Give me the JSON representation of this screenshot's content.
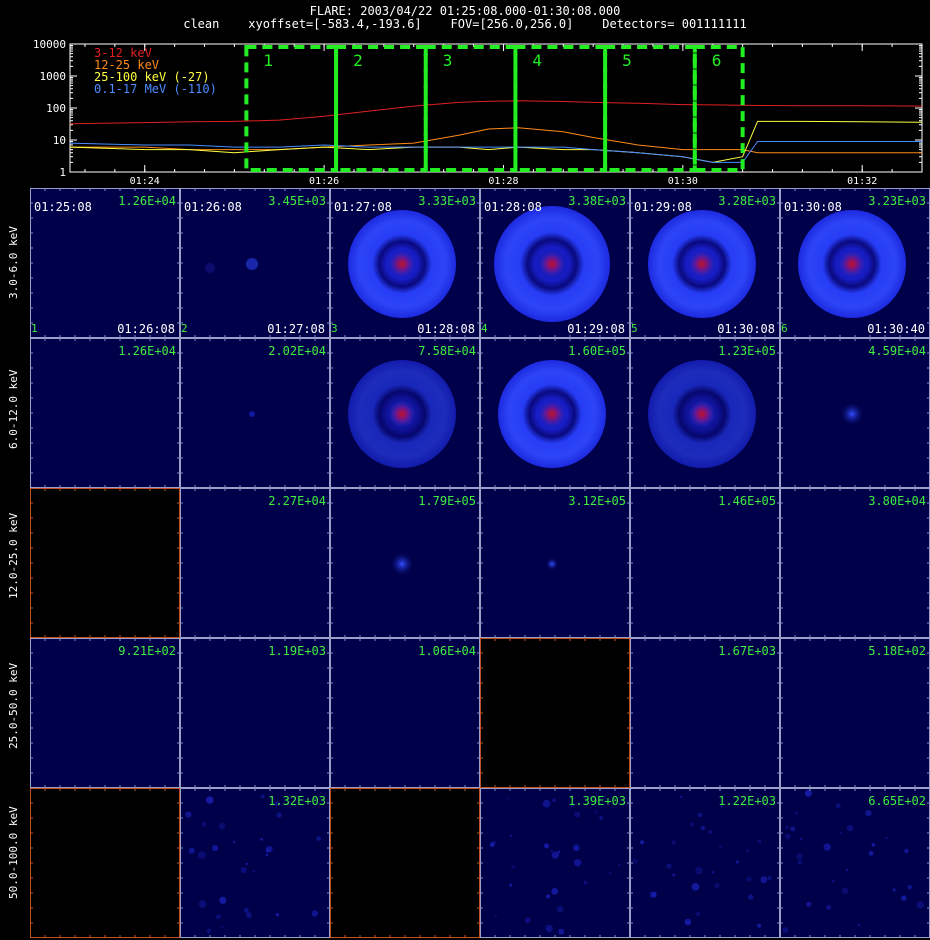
{
  "header": {
    "line1": "FLARE: 2003/04/22 01:25:08.000-01:30:08.000",
    "line2": "clean    xyoffset=[-583.4,-193.6]    FOV=[256.0,256.0]    Detectors= 001111111"
  },
  "chart_data": [
    {
      "type": "line",
      "name": "lightcurve",
      "ylog": true,
      "ylim": [
        1,
        10000
      ],
      "yticks": [
        "1",
        "10",
        "100",
        "1000",
        "10000"
      ],
      "xlim": [
        "01:23:10",
        "01:32:40"
      ],
      "xticks": [
        "01:24",
        "01:26",
        "01:28",
        "01:30",
        "01:32"
      ],
      "intervals": [
        {
          "label": "1",
          "start": "01:25:08",
          "end": "01:26:08"
        },
        {
          "label": "2",
          "start": "01:26:08",
          "end": "01:27:08"
        },
        {
          "label": "3",
          "start": "01:27:08",
          "end": "01:28:08"
        },
        {
          "label": "4",
          "start": "01:28:08",
          "end": "01:29:08"
        },
        {
          "label": "5",
          "start": "01:29:08",
          "end": "01:30:08"
        },
        {
          "label": "6",
          "start": "01:30:08",
          "end": "01:30:40"
        }
      ],
      "x": [
        "01:23:10",
        "01:24:00",
        "01:24:30",
        "01:25:00",
        "01:25:30",
        "01:26:00",
        "01:26:30",
        "01:27:00",
        "01:27:30",
        "01:27:50",
        "01:28:10",
        "01:28:40",
        "01:29:00",
        "01:29:30",
        "01:30:00",
        "01:30:20",
        "01:30:40",
        "01:30:50",
        "01:31:20",
        "01:32:00",
        "01:32:40"
      ],
      "series": [
        {
          "name": "3-12 keV",
          "color": "#e02020",
          "values": [
            32,
            35,
            37,
            38,
            42,
            55,
            80,
            115,
            150,
            162,
            168,
            160,
            150,
            140,
            128,
            125,
            122,
            120,
            118,
            118,
            115
          ]
        },
        {
          "name": "12-25 keV",
          "color": "#ff8c1a",
          "values": [
            6,
            6,
            5,
            5,
            5,
            6,
            7,
            8,
            14,
            22,
            24,
            18,
            12,
            7,
            5,
            5,
            5,
            4,
            4,
            4,
            4
          ]
        },
        {
          "name": "25-100 keV (-27)",
          "color": "#ffff40",
          "values": [
            6,
            5,
            5,
            4,
            5,
            6,
            5,
            6,
            6,
            5,
            6,
            5,
            5,
            4,
            3,
            2,
            3,
            38,
            38,
            37,
            36
          ]
        },
        {
          "name": "0.1-17 MeV (-110)",
          "color": "#4a8cff",
          "values": [
            8,
            7,
            7,
            6,
            6,
            7,
            6,
            6,
            6,
            6,
            6,
            6,
            5,
            4,
            3,
            2,
            2,
            9,
            9,
            9,
            9
          ]
        }
      ]
    },
    {
      "type": "heatmap",
      "name": "image-grid",
      "column_times": [
        {
          "index": "1",
          "start": "01:25:08",
          "end": "01:26:08"
        },
        {
          "index": "2",
          "start": "01:26:08",
          "end": "01:27:08"
        },
        {
          "index": "3",
          "start": "01:27:08",
          "end": "01:28:08"
        },
        {
          "index": "4",
          "start": "01:28:08",
          "end": "01:29:08"
        },
        {
          "index": "5",
          "start": "01:29:08",
          "end": "01:30:08"
        },
        {
          "index": "6",
          "start": "01:30:08",
          "end": "01:30:40"
        }
      ],
      "rows": [
        {
          "band": "3.0-6.0 keV",
          "peaks": [
            "1.26E+04",
            "3.45E+03",
            "3.33E+03",
            "3.38E+03",
            "3.28E+03",
            "3.23E+03"
          ],
          "source": [
            "none",
            "faint",
            "ring",
            "ring-bright",
            "ring",
            "ring"
          ]
        },
        {
          "band": "6.0-12.0 keV",
          "peaks": [
            "1.26E+04",
            "2.02E+04",
            "7.58E+04",
            "1.60E+05",
            "1.23E+05",
            "4.59E+04"
          ],
          "source": [
            "none",
            "speck",
            "ring-dim",
            "ring",
            "ring-dim",
            "blob"
          ]
        },
        {
          "band": "12.0-25.0 keV",
          "peaks": [
            "",
            "2.27E+04",
            "1.79E+05",
            "3.12E+05",
            "1.46E+05",
            "3.80E+04"
          ],
          "source": [
            "black",
            "none",
            "blob",
            "blob-small",
            "none",
            "none"
          ]
        },
        {
          "band": "25.0-50.0 keV",
          "peaks": [
            "9.21E+02",
            "1.19E+03",
            "1.06E+04",
            "",
            "1.67E+03",
            "5.18E+02"
          ],
          "source": [
            "none",
            "none",
            "none",
            "black",
            "none",
            "none"
          ]
        },
        {
          "band": "50.0-100.0 keV",
          "peaks": [
            "",
            "1.32E+03",
            "",
            "1.39E+03",
            "1.22E+03",
            "6.65E+02"
          ],
          "source": [
            "black",
            "noise",
            "black",
            "noise",
            "noise",
            "noise"
          ]
        }
      ]
    }
  ]
}
